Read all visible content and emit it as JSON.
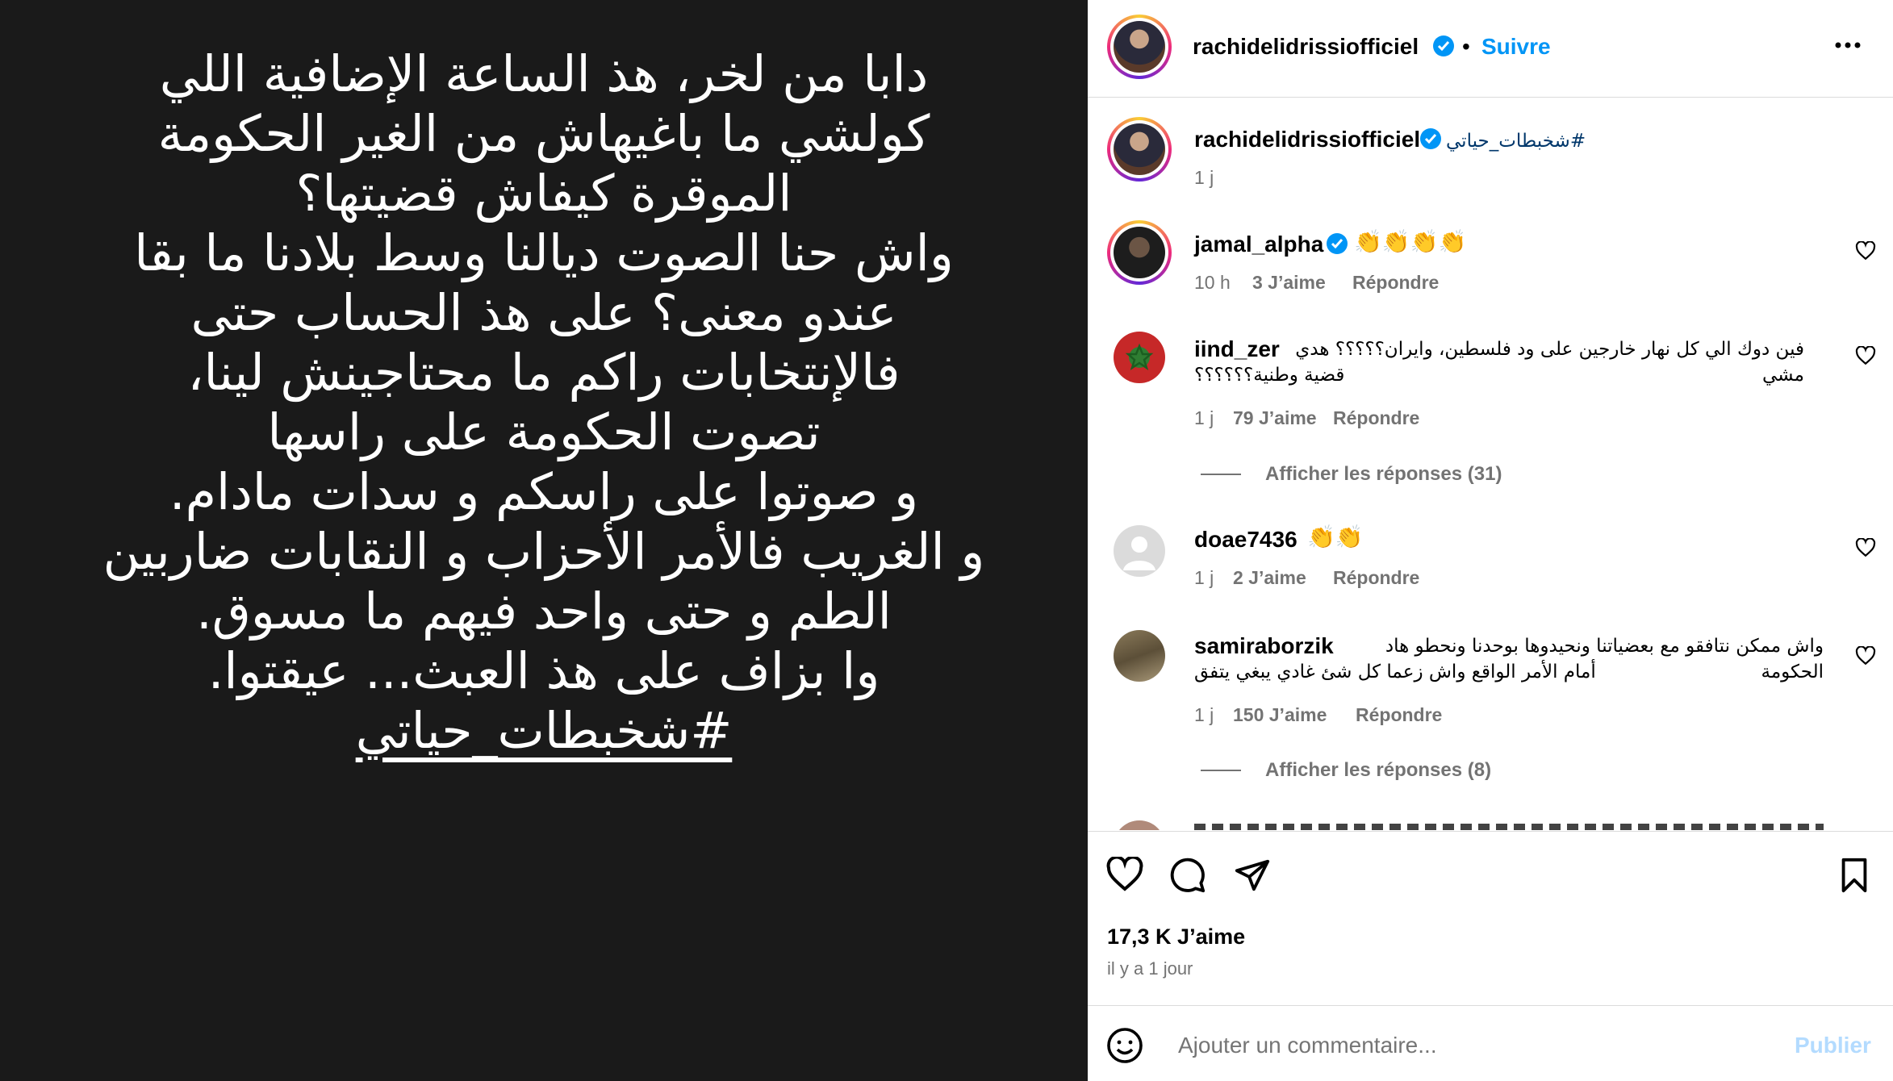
{
  "post": {
    "image_lines": [
      "دابا من لخر، هذ الساعة الإضافية اللي",
      "كولشي ما باغيهاش من الغير الحكومة",
      "الموقرة كيفاش قضيتها؟",
      "واش حنا الصوت ديالنا وسط بلادنا ما بقا",
      "عندو معنى؟ على هذ الحساب حتى",
      "فالإنتخابات راكم ما محتاجينش لينا،",
      "تصوت الحكومة على راسها",
      "و صوتوا على راسكم و سدات مادام.",
      "و الغريب فالأمر الأحزاب و النقابات ضاربين",
      "الطم و حتى واحد فيهم ما مسوق.",
      "وا بزاف على هذ العبث... عيقتوا."
    ],
    "image_hashtag": "#شخبطات_حياتي"
  },
  "header": {
    "username": "rachidelidrissiofficiel",
    "separator": "•",
    "follow_label": "Suivre"
  },
  "caption": {
    "username": "rachidelidrissiofficiel",
    "text": "#شخبطات_حياتي",
    "time": "1 j"
  },
  "comments": [
    {
      "username": "jamal_alpha",
      "text": "👏👏👏👏",
      "time": "10 h",
      "likes": "3 J’aime",
      "reply": "Répondre"
    },
    {
      "username": "iind_zer",
      "text_line1": "فين دوك الي كل نهار خارجين على ود فلسطين، وايران؟؟؟؟؟ هدي مشي",
      "text_line2": "قضية وطنية؟؟؟؟؟؟",
      "time": "1 j",
      "likes": "79 J’aime",
      "reply": "Répondre",
      "replies": "Afficher les réponses (31)"
    },
    {
      "username": "doae7436",
      "text": "👏👏",
      "time": "1 j",
      "likes": "2 J’aime",
      "reply": "Répondre"
    },
    {
      "username": "samiraborzik",
      "text_line1": "واش ممكن نتافقو مع بعضياتنا ونحيدوها بوحدنا ونحطو هاد الحكومة",
      "text_line2": "أمام الأمر الواقع واش زعما كل شئ غادي يبغي يتفق",
      "time": "1 j",
      "likes": "150 J’aime",
      "reply": "Répondre",
      "replies": "Afficher les réponses (8)"
    }
  ],
  "footer": {
    "likes": "17,3 K J’aime",
    "time_ago": "il y a 1 jour",
    "comment_placeholder": "Ajouter un commentaire...",
    "publish_label": "Publier"
  },
  "colors": {
    "accent": "#0095f6",
    "muted": "#737373",
    "image_bg": "#1a1a1a",
    "publish_disabled": "#b3dbff"
  }
}
